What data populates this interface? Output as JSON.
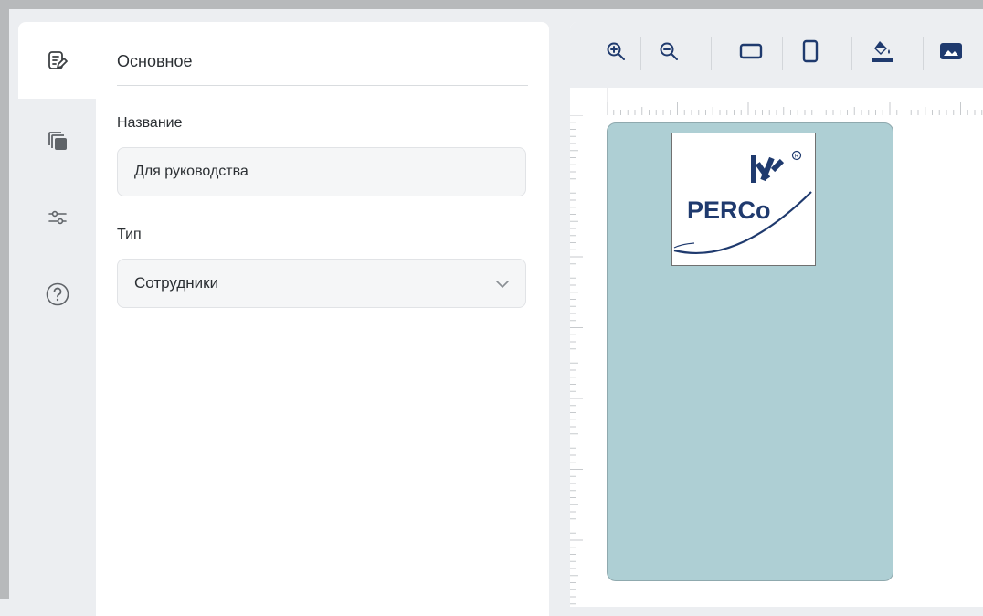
{
  "sidebar": {
    "items": [
      {
        "icon": "edit-form-icon",
        "active": true
      },
      {
        "icon": "layers-icon",
        "active": false
      },
      {
        "icon": "sliders-icon",
        "active": false
      },
      {
        "icon": "help-icon",
        "active": false
      }
    ]
  },
  "form": {
    "section_title": "Основное",
    "name_label": "Название",
    "name_value": "Для руководства",
    "type_label": "Тип",
    "type_value": "Сотрудники"
  },
  "toolbar": {
    "tools": [
      "zoom-in-icon",
      "zoom-out-icon",
      "landscape-icon",
      "portrait-icon",
      "fill-color-icon",
      "image-icon"
    ]
  },
  "canvas": {
    "card_color": "#aecfd4",
    "logo_text": "PERCo"
  },
  "colors": {
    "accent": "#1f3a6e",
    "icon": "#5f6368",
    "card": "#aecfd4"
  }
}
